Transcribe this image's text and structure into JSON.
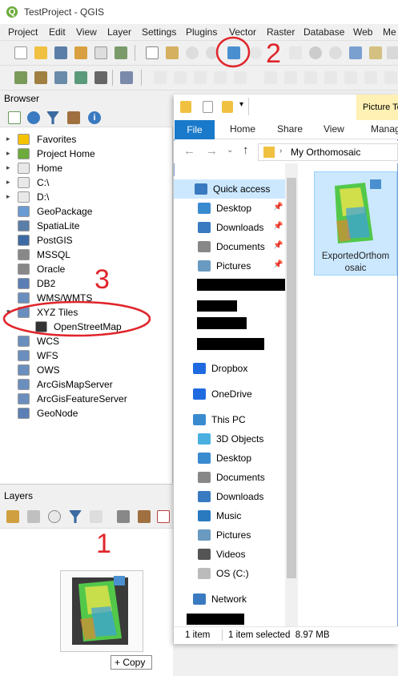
{
  "qgis": {
    "title": "TestProject - QGIS",
    "title_icon": "Q",
    "menus": [
      "Project",
      "Edit",
      "View",
      "Layer",
      "Settings",
      "Plugins",
      "Vector",
      "Raster",
      "Database",
      "Web",
      "Me"
    ],
    "browser_title": "Browser",
    "browser_items": [
      {
        "label": "Favorites",
        "icon": "star-icon",
        "color": "#f5c200",
        "arrow": "▸"
      },
      {
        "label": "Project Home",
        "icon": "project-home-icon",
        "color": "#6dab3c",
        "arrow": "▸"
      },
      {
        "label": "Home",
        "icon": "home-folder-icon",
        "color": "#e8e8e8",
        "arrow": "▸"
      },
      {
        "label": "C:\\",
        "icon": "drive-icon",
        "color": "#e8e8e8",
        "arrow": "▸"
      },
      {
        "label": "D:\\",
        "icon": "drive-icon",
        "color": "#e8e8e8",
        "arrow": "▸"
      },
      {
        "label": "GeoPackage",
        "icon": "geopackage-icon",
        "color": "#6a9bd2",
        "arrow": ""
      },
      {
        "label": "SpatiaLite",
        "icon": "spatialite-icon",
        "color": "#5a7ea8",
        "arrow": ""
      },
      {
        "label": "PostGIS",
        "icon": "postgis-icon",
        "color": "#3d6aa4",
        "arrow": ""
      },
      {
        "label": "MSSQL",
        "icon": "mssql-icon",
        "color": "#888888",
        "arrow": ""
      },
      {
        "label": "Oracle",
        "icon": "oracle-icon",
        "color": "#888888",
        "arrow": ""
      },
      {
        "label": "DB2",
        "icon": "db2-icon",
        "color": "#5b7fb5",
        "arrow": ""
      },
      {
        "label": "WMS/WMTS",
        "icon": "wms-icon",
        "color": "#6a8fbf",
        "arrow": ""
      },
      {
        "label": "XYZ Tiles",
        "icon": "xyz-tiles-icon",
        "color": "#6a8fbf",
        "arrow": "▾"
      },
      {
        "label": "OpenStreetMap",
        "icon": "openstreetmap-icon",
        "color": "#333333",
        "arrow": "",
        "child": true
      },
      {
        "label": "WCS",
        "icon": "wcs-icon",
        "color": "#6a8fbf",
        "arrow": ""
      },
      {
        "label": "WFS",
        "icon": "wfs-icon",
        "color": "#6a8fbf",
        "arrow": ""
      },
      {
        "label": "OWS",
        "icon": "ows-icon",
        "color": "#6a8fbf",
        "arrow": ""
      },
      {
        "label": "ArcGisMapServer",
        "icon": "arcgis-mapserver-icon",
        "color": "#6a8fbf",
        "arrow": ""
      },
      {
        "label": "ArcGisFeatureServer",
        "icon": "arcgis-featureserver-icon",
        "color": "#6a8fbf",
        "arrow": ""
      },
      {
        "label": "GeoNode",
        "icon": "geonode-icon",
        "color": "#5b7fb5",
        "arrow": ""
      }
    ],
    "layers_title": "Layers",
    "copy_tooltip": "+ Copy"
  },
  "annotations": [
    "1",
    "2",
    "3"
  ],
  "explorer": {
    "picture_tools": "Picture To",
    "tabs": {
      "file": "File",
      "home": "Home",
      "share": "Share",
      "view": "View",
      "manage": "Manag"
    },
    "address": "My Orthomosaic",
    "nav_quick": [
      {
        "label": "Quick access",
        "icon": "quick-access-star-icon",
        "pin": ""
      },
      {
        "label": "Desktop",
        "icon": "desktop-icon",
        "pin": "📌"
      },
      {
        "label": "Downloads",
        "icon": "downloads-icon",
        "pin": "📌"
      },
      {
        "label": "Documents",
        "icon": "documents-icon",
        "pin": "📌"
      },
      {
        "label": "Pictures",
        "icon": "pictures-icon",
        "pin": "📌"
      }
    ],
    "nav_other": [
      {
        "label": "Dropbox",
        "icon": "dropbox-icon"
      },
      {
        "label": "OneDrive",
        "icon": "onedrive-icon"
      },
      {
        "label": "This PC",
        "icon": "this-pc-icon"
      },
      {
        "label": "3D Objects",
        "icon": "3d-objects-icon"
      },
      {
        "label": "Desktop",
        "icon": "desktop-icon"
      },
      {
        "label": "Documents",
        "icon": "documents-icon"
      },
      {
        "label": "Downloads",
        "icon": "downloads-icon"
      },
      {
        "label": "Music",
        "icon": "music-icon"
      },
      {
        "label": "Pictures",
        "icon": "pictures-icon"
      },
      {
        "label": "Videos",
        "icon": "videos-icon"
      },
      {
        "label": "OS (C:)",
        "icon": "os-drive-icon"
      },
      {
        "label": "Network",
        "icon": "network-icon"
      }
    ],
    "file_name_line1": "ExportedOrthom",
    "file_name_line2": "osaic",
    "status_count": "1 item",
    "status_selected": "1 item selected  8.97 MB"
  },
  "colors": {
    "annotation": "#e0252b",
    "selection": "#cce8ff",
    "file_tab": "#1979ca"
  }
}
